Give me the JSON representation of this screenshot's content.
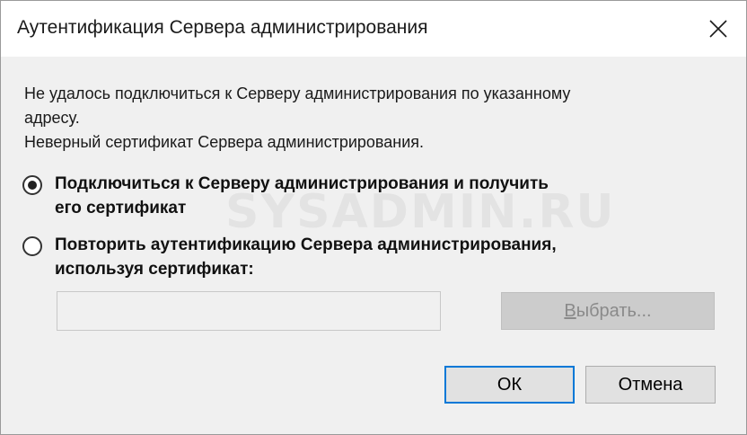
{
  "window": {
    "title": "Аутентификация Сервера администрирования",
    "close_icon": "close-icon"
  },
  "message": {
    "lines": [
      "Не удалось подключиться к Серверу администрирования по указанному",
      "адресу.",
      "Неверный сертификат Сервера администрирования."
    ]
  },
  "options": [
    {
      "lines": [
        "Подключиться к Серверу администрирования и получить",
        "его сертификат"
      ],
      "selected": true
    },
    {
      "lines": [
        "Повторить аутентификацию Сервера администрирования,",
        "используя сертификат:"
      ],
      "selected": false
    }
  ],
  "certificate": {
    "value": "",
    "browse_mnemonic": "В",
    "browse_rest": "ыбрать..."
  },
  "buttons": {
    "ok": "ОК",
    "cancel": "Отмена"
  },
  "watermark": "SYSADMIN.RU",
  "colors": {
    "accent": "#0078d7",
    "background": "#f0f0f0",
    "titlebar": "#ffffff"
  }
}
